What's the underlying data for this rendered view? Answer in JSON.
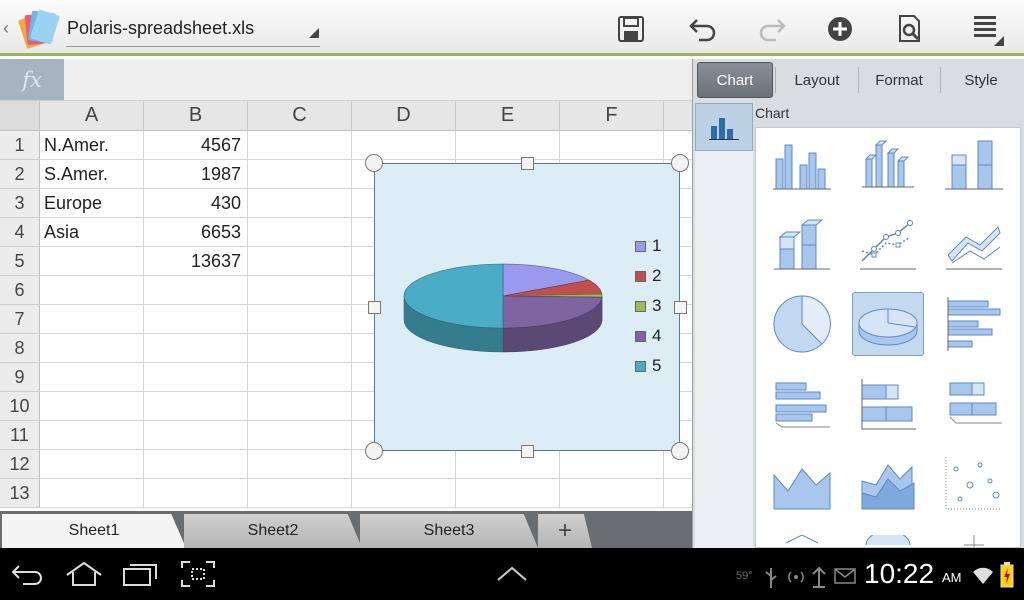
{
  "app": {
    "file_name": "Polaris-spreadsheet.xls"
  },
  "toolbar": {
    "icons": [
      "save-icon",
      "undo-icon",
      "redo-icon",
      "insert-icon",
      "find-icon",
      "menu-icon"
    ]
  },
  "formula": {
    "fx_label": "fx",
    "value": ""
  },
  "sheet": {
    "columns": [
      "A",
      "B",
      "C",
      "D",
      "E",
      "F"
    ],
    "rows": [
      "1",
      "2",
      "3",
      "4",
      "5",
      "6",
      "7",
      "8",
      "9",
      "10",
      "11",
      "12",
      "13"
    ],
    "cells": {
      "A1": "N.Amer.",
      "B1": "4567",
      "A2": "S.Amer.",
      "B2": "1987",
      "A3": "Europe",
      "B3": "430",
      "A4": "Asia",
      "B4": "6653",
      "B5": "13637"
    }
  },
  "chart_data": {
    "type": "pie",
    "style": "3d",
    "title": "",
    "categories": [
      "1",
      "2",
      "3",
      "4",
      "5"
    ],
    "values": [
      4567,
      1987,
      430,
      6653,
      13637
    ],
    "colors": [
      "#9999ee",
      "#c0504d",
      "#9bbb59",
      "#8064a2",
      "#4bacc6"
    ],
    "legend_position": "right"
  },
  "tabs": {
    "sheets": [
      "Sheet1",
      "Sheet2",
      "Sheet3"
    ],
    "active": "Sheet1",
    "add_label": "+"
  },
  "panel": {
    "tabs": [
      "Chart",
      "Layout",
      "Format",
      "Style"
    ],
    "active_tab": "Chart",
    "section_title": "Chart",
    "chart_types": [
      "clustered-column",
      "3d-column",
      "stacked-column",
      "3d-stacked-column",
      "line-markers",
      "3d-line",
      "pie",
      "3d-pie",
      "clustered-bar",
      "3d-bar",
      "stacked-bar",
      "3d-stacked-bar",
      "area",
      "3d-area",
      "scatter"
    ],
    "selected_type": "3d-pie"
  },
  "statusbar": {
    "temperature": "59°",
    "time": "10:22",
    "ampm": "AM"
  }
}
